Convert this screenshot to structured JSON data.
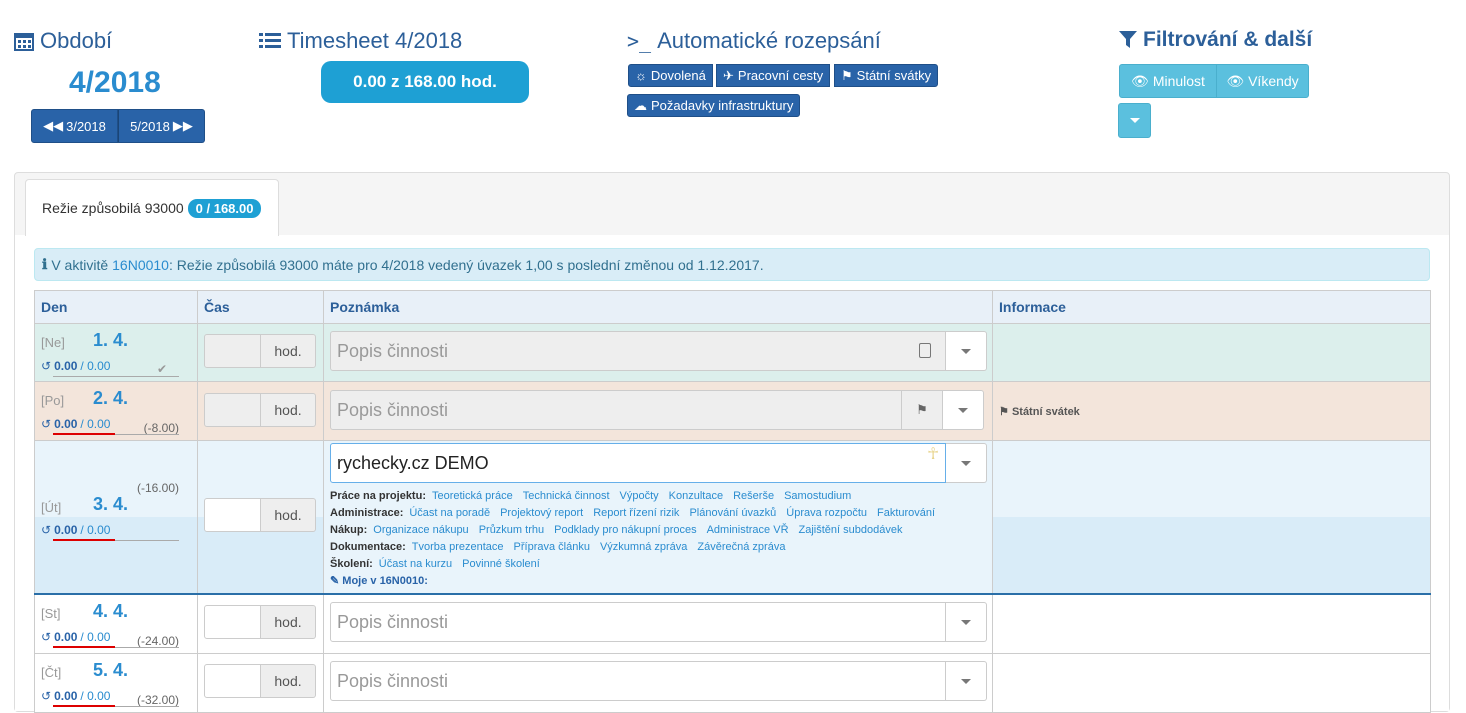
{
  "period": {
    "title": "Období",
    "current": "4/2018",
    "prev_label": "3/2018",
    "next_label": "5/2018"
  },
  "timesheet": {
    "title": "Timesheet 4/2018",
    "total": "0.00 z 168.00 hod."
  },
  "auto": {
    "title": "Automatické rozepsání",
    "buttons": [
      "Dovolená",
      "Pracovní cesty",
      "Státní svátky",
      "Požadavky infrastruktury"
    ]
  },
  "filter": {
    "title": "Filtrování & další",
    "past_label": "Minulost",
    "weekend_label": "Víkendy"
  },
  "tab": {
    "label": "Režie způsobilá 93000",
    "badge": "0 / 168.00"
  },
  "alert": {
    "prefix": "V aktivitě",
    "link": "16N0010",
    "text": ": Režie způsobilá 93000 máte pro 4/2018 vedený úvazek 1,00 s poslední změnou od 1.12.2017."
  },
  "columns": {
    "day": "Den",
    "time": "Čas",
    "note": "Poznámka",
    "info": "Informace"
  },
  "unit": "hod.",
  "note_placeholder": "Popis činnosti",
  "rows": [
    {
      "dname": "[Ne]",
      "date": "1. 4.",
      "done": "0.00",
      "total": "/ 0.00",
      "diff": ""
    },
    {
      "dname": "[Po]",
      "date": "2. 4.",
      "done": "0.00",
      "total": "/ 0.00",
      "diff": "(-8.00)",
      "info": "Státní svátek"
    },
    {
      "dname": "[Út]",
      "date": "3. 4.",
      "done": "0.00",
      "total": "/ 0.00",
      "diff": "(-16.00)",
      "note_value": "rychecky.cz DEMO"
    },
    {
      "dname": "[St]",
      "date": "4. 4.",
      "done": "0.00",
      "total": "/ 0.00",
      "diff": "(-24.00)"
    },
    {
      "dname": "[Čt]",
      "date": "5. 4.",
      "done": "0.00",
      "total": "/ 0.00",
      "diff": "(-32.00)"
    }
  ],
  "quick": {
    "projekt": {
      "cat": "Práce na projektu:",
      "items": [
        "Teoretická práce",
        "Technická činnost",
        "Výpočty",
        "Konzultace",
        "Rešerše",
        "Samostudium"
      ]
    },
    "admin": {
      "cat": "Administrace:",
      "items": [
        "Účast na poradě",
        "Projektový report",
        "Report řízení rizik",
        "Plánování úvazků",
        "Úprava rozpočtu",
        "Fakturování"
      ]
    },
    "nakup": {
      "cat": "Nákup:",
      "items": [
        "Organizace nákupu",
        "Průzkum trhu",
        "Podklady pro nákupní proces",
        "Administrace VŘ",
        "Zajištění subdodávek"
      ]
    },
    "dok": {
      "cat": "Dokumentace:",
      "items": [
        "Tvorba prezentace",
        "Příprava článku",
        "Výzkumná zpráva",
        "Závěrečná zpráva"
      ]
    },
    "skol": {
      "cat": "Školení:",
      "items": [
        "Účast na kurzu",
        "Povinné školení"
      ]
    },
    "moje": "Moje v 16N0010:"
  }
}
